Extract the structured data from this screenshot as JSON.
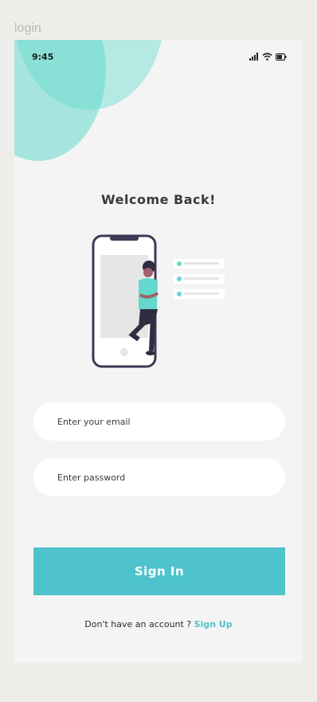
{
  "frame_label": "login",
  "status_bar": {
    "time": "9:45",
    "icons": [
      "signal-icon",
      "wifi-icon",
      "battery-icon"
    ]
  },
  "title": "Welcome Back!",
  "form": {
    "email_placeholder": "Enter your email",
    "email_value": "",
    "password_placeholder": "Enter password",
    "password_value": "",
    "signin_label": "Sign In"
  },
  "footer": {
    "prompt": "Don't have an account ? ",
    "signup_label": "Sign Up"
  },
  "colors": {
    "accent": "#4fc3cb",
    "blob": "#64d8cc",
    "background": "#f4f4f4",
    "outer": "#efedea"
  }
}
